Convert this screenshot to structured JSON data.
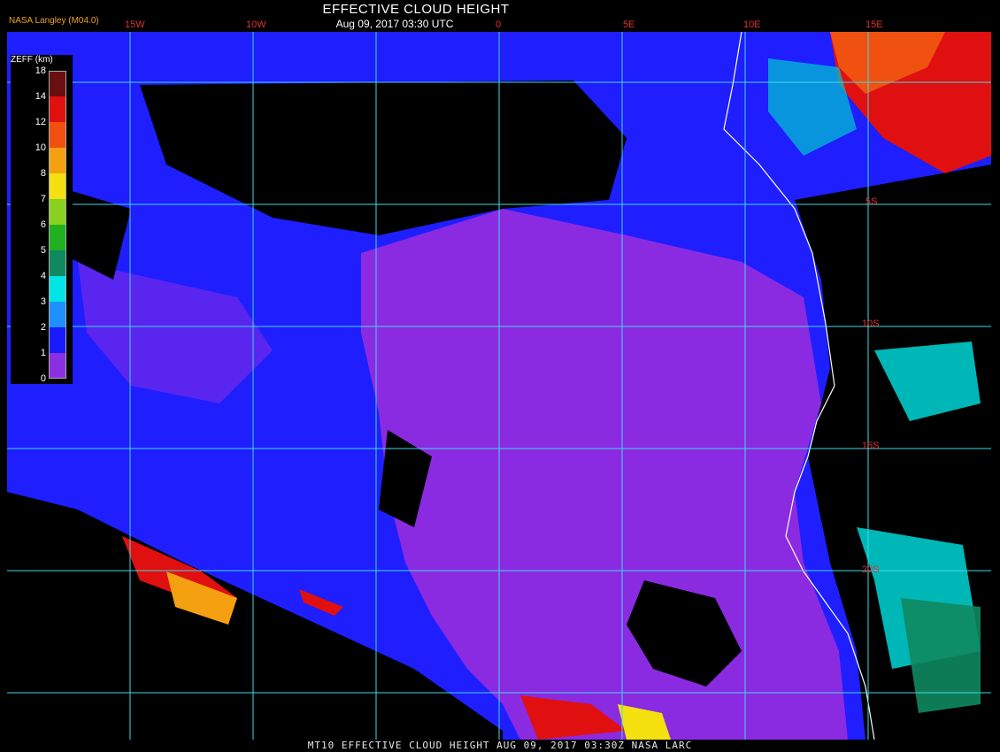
{
  "header": {
    "title": "EFFECTIVE CLOUD HEIGHT",
    "subtitle": "Aug 09, 2017 03:30 UTC",
    "org": "NASA Langley (M04.0)"
  },
  "footer": {
    "text": "MT10  EFFECTIVE CLOUD HEIGHT   AUG 09, 2017 03:30Z   NASA LARC"
  },
  "longitude_labels": [
    "15W",
    "10W",
    "0",
    "5E",
    "10E",
    "15E"
  ],
  "latitude_labels": [
    "5S",
    "10S",
    "15S",
    "20S"
  ],
  "legend": {
    "title": "ZEFF (km)",
    "ticks": [
      "18",
      "14",
      "12",
      "10",
      "8",
      "7",
      "6",
      "5",
      "4",
      "3",
      "2",
      "1",
      "0"
    ],
    "colors": [
      "#6a0f0f",
      "#e01010",
      "#f05010",
      "#f5a010",
      "#f5e010",
      "#8ad020",
      "#20b020",
      "#108860",
      "#00e5e5",
      "#1e90ff",
      "#1a1aff",
      "#8a30e0"
    ]
  },
  "colors": {
    "ocean_clear": "#000000",
    "low_cloud": "#8a2be2",
    "mid_low_cloud": "#1e1eff",
    "grid": "#40d8e8",
    "label_red": "#e03030",
    "coastline": "#ffffff"
  }
}
